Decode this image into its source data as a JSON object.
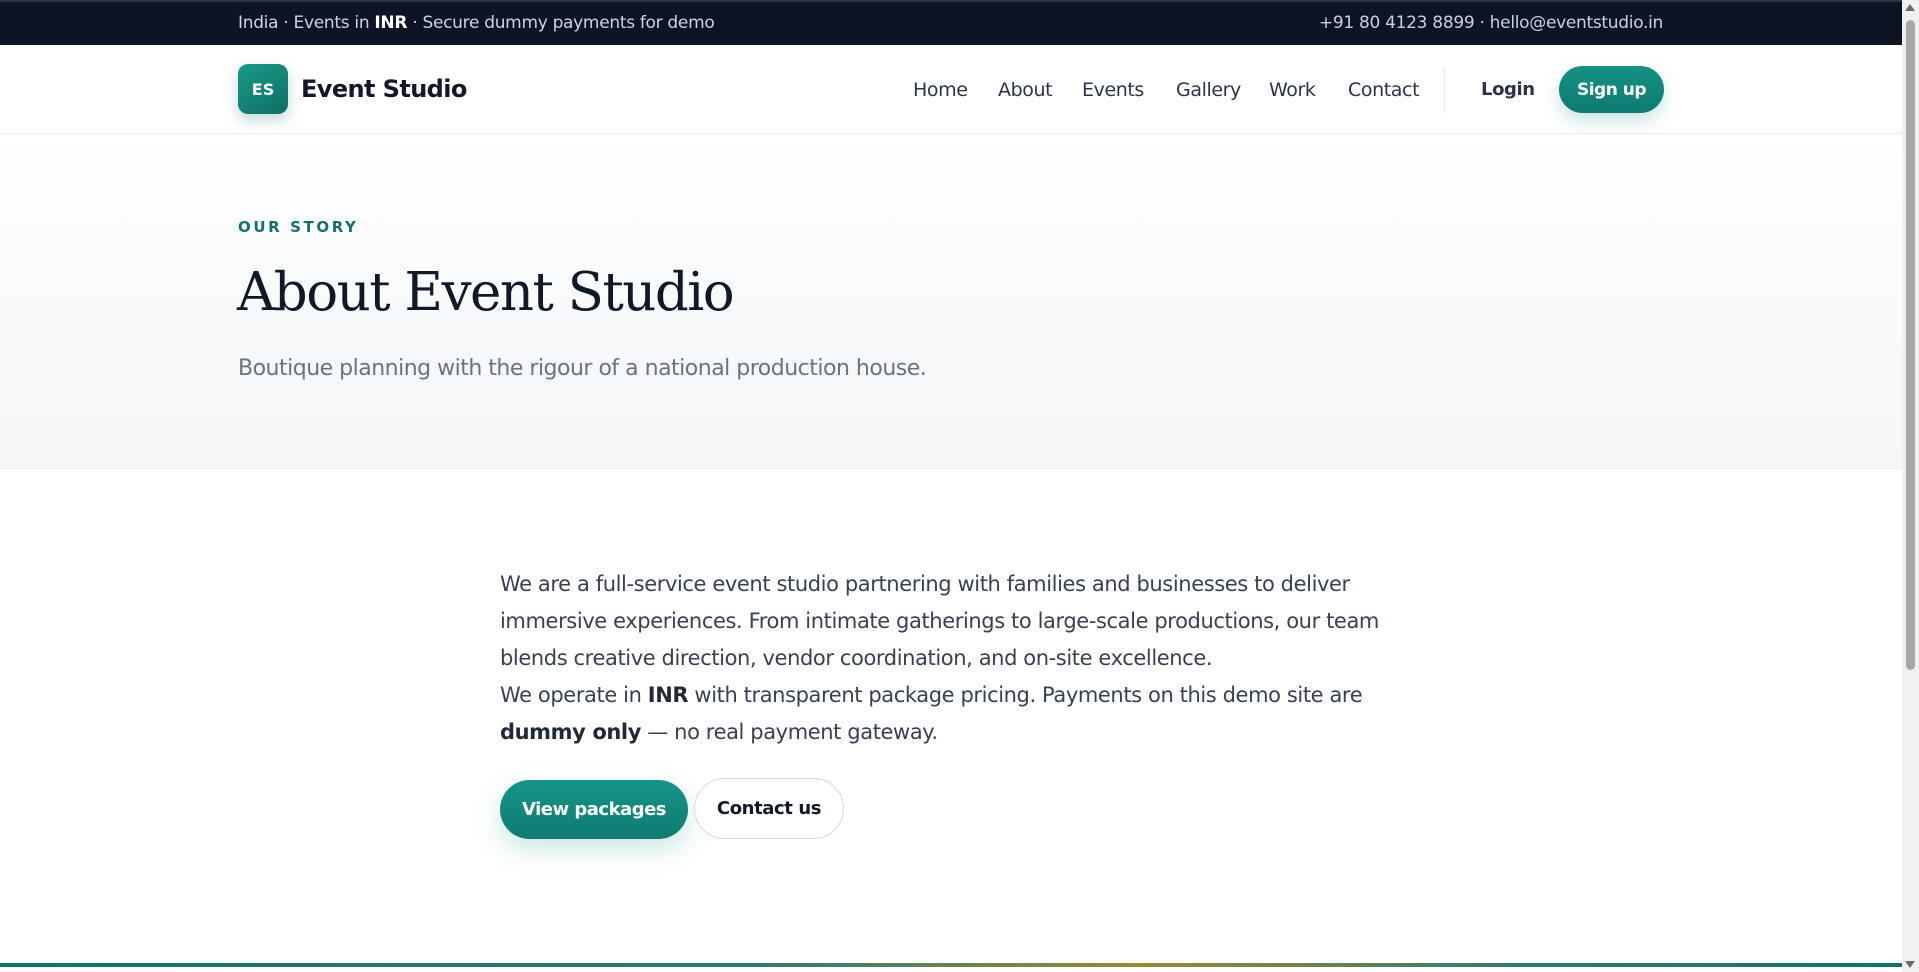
{
  "topbar": {
    "left_pre": "India · Events in ",
    "left_bold": "INR",
    "left_post": " · Secure dummy payments for demo",
    "contact": "+91 80 4123 8899 · hello@eventstudio.in"
  },
  "header": {
    "logo_initials": "ES",
    "brand": "Event Studio",
    "nav": [
      "Home",
      "About",
      "Events",
      "Gallery",
      "Work",
      "Contact"
    ],
    "login": "Login",
    "signup": "Sign up"
  },
  "hero": {
    "eyebrow": "OUR STORY",
    "title": "About Event Studio",
    "subtitle": "Boutique planning with the rigour of a national production house."
  },
  "content": {
    "para1": "We are a full-service event studio partnering with families and businesses to deliver immersive experiences. From intimate gatherings to large-scale productions, our team blends creative direction, vendor coordination, and on-site excellence.",
    "para2_a": "We operate in ",
    "para2_b": "INR",
    "para2_c": " with transparent package pricing. Payments on this demo site are ",
    "para2_d": "dummy only",
    "para2_e": " — no real payment gateway.",
    "primary_button": "View packages",
    "secondary_button": "Contact us"
  },
  "colors": {
    "accent": "#0f7b70",
    "topbar_bg": "#0d1424",
    "text": "#1f2937"
  }
}
